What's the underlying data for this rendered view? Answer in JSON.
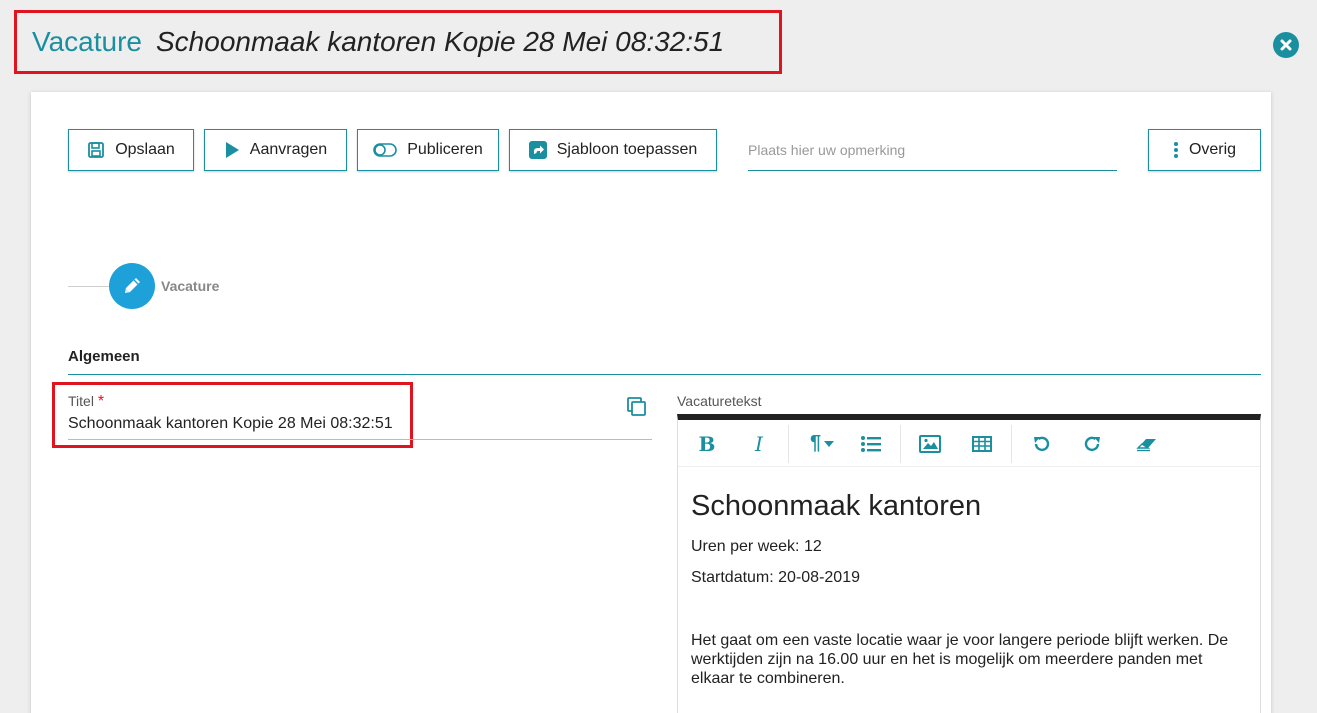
{
  "header": {
    "prefix": "Vacature",
    "title": "Schoonmaak kantoren Kopie 28 Mei 08:32:51"
  },
  "toolbar": {
    "save_label": "Opslaan",
    "request_label": "Aanvragen",
    "publish_label": "Publiceren",
    "template_label": "Sjabloon toepassen",
    "remark_placeholder": "Plaats hier uw opmerking",
    "more_label": "Overig"
  },
  "stepper": {
    "step_label": "Vacature"
  },
  "section": {
    "title": "Algemeen"
  },
  "titel_field": {
    "label": "Titel",
    "required_mark": "*",
    "value": "Schoonmaak kantoren Kopie 28 Mei 08:32:51"
  },
  "editor": {
    "label": "Vacaturetekst",
    "toolbar": {
      "bold": "B",
      "italic": "I",
      "paragraph": "¶"
    },
    "content": {
      "heading": "Schoonmaak kantoren",
      "hours": "Uren per week: 12",
      "start_date": "Startdatum: 20-08-2019",
      "body": "Het gaat om een vaste locatie waar je voor langere periode blijft werken. De werktijden zijn na 16.00 uur en het is mogelijk om meerdere panden met elkaar te combineren."
    }
  },
  "colors": {
    "accent": "#1a8fa0",
    "highlight": "#e0141e",
    "step_circle": "#1ea0d8"
  }
}
